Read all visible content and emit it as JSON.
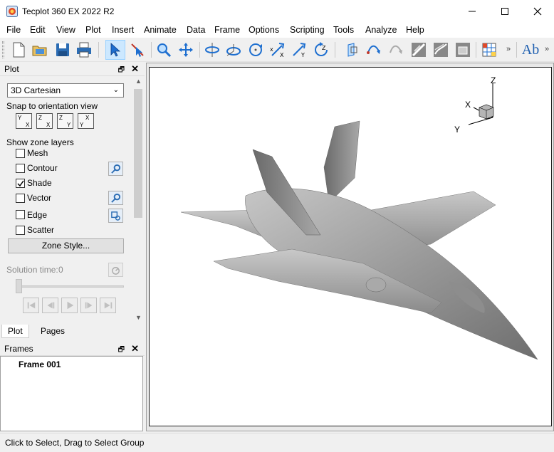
{
  "window": {
    "title": "Tecplot 360 EX 2022 R2"
  },
  "menu": [
    "File",
    "Edit",
    "View",
    "Plot",
    "Insert",
    "Animate",
    "Data",
    "Frame",
    "Options",
    "Scripting",
    "Tools",
    "Analyze",
    "Help"
  ],
  "toolbar": {
    "buttons": [
      "new-layout-icon",
      "open-icon",
      "save-icon",
      "print-icon",
      "select-arrow-icon",
      "adjust-icon",
      "zoom-icon",
      "translate-icon",
      "rotate-spherical-icon",
      "rotate-rollerball-icon",
      "rotate-twist-icon",
      "rotate-x-icon",
      "rotate-y-icon",
      "rotate-z-icon",
      "slice-icon",
      "streamtrace-icon",
      "streamtrace-disabled-icon",
      "probe-icon",
      "contour-label-icon",
      "frame-icon",
      "contour-legend-icon",
      "text-icon"
    ],
    "text_tool": "Ab"
  },
  "plot_panel": {
    "title": "Plot",
    "plot_type": "3D Cartesian",
    "snap_label": "Snap to orientation view",
    "orientation_views": [
      {
        "v": "Y",
        "h": "X"
      },
      {
        "v": "Z",
        "h": "X"
      },
      {
        "v": "Z",
        "h": "Y"
      },
      {
        "v": "X",
        "h": "Y"
      }
    ],
    "zone_layers_label": "Show zone layers",
    "layers": [
      {
        "label": "Mesh",
        "checked": false,
        "has_settings": false
      },
      {
        "label": "Contour",
        "checked": false,
        "has_settings": true
      },
      {
        "label": "Shade",
        "checked": true,
        "has_settings": false
      },
      {
        "label": "Vector",
        "checked": false,
        "has_settings": true
      },
      {
        "label": "Edge",
        "checked": false,
        "has_settings": true
      },
      {
        "label": "Scatter",
        "checked": false,
        "has_settings": false
      }
    ],
    "zone_style_button": "Zone Style...",
    "solution_time_label": "Solution time:",
    "solution_time_value": "0"
  },
  "tabs": [
    "Plot",
    "Pages"
  ],
  "frames_panel": {
    "title": "Frames",
    "items": [
      "Frame 001"
    ]
  },
  "axis_triad": {
    "x": "X",
    "y": "Y",
    "z": "Z"
  },
  "status": {
    "text": "Click to Select, Drag to Select Group"
  },
  "colors": {
    "accent": "#cce8ff",
    "model_shade": "#9a9a9a"
  }
}
